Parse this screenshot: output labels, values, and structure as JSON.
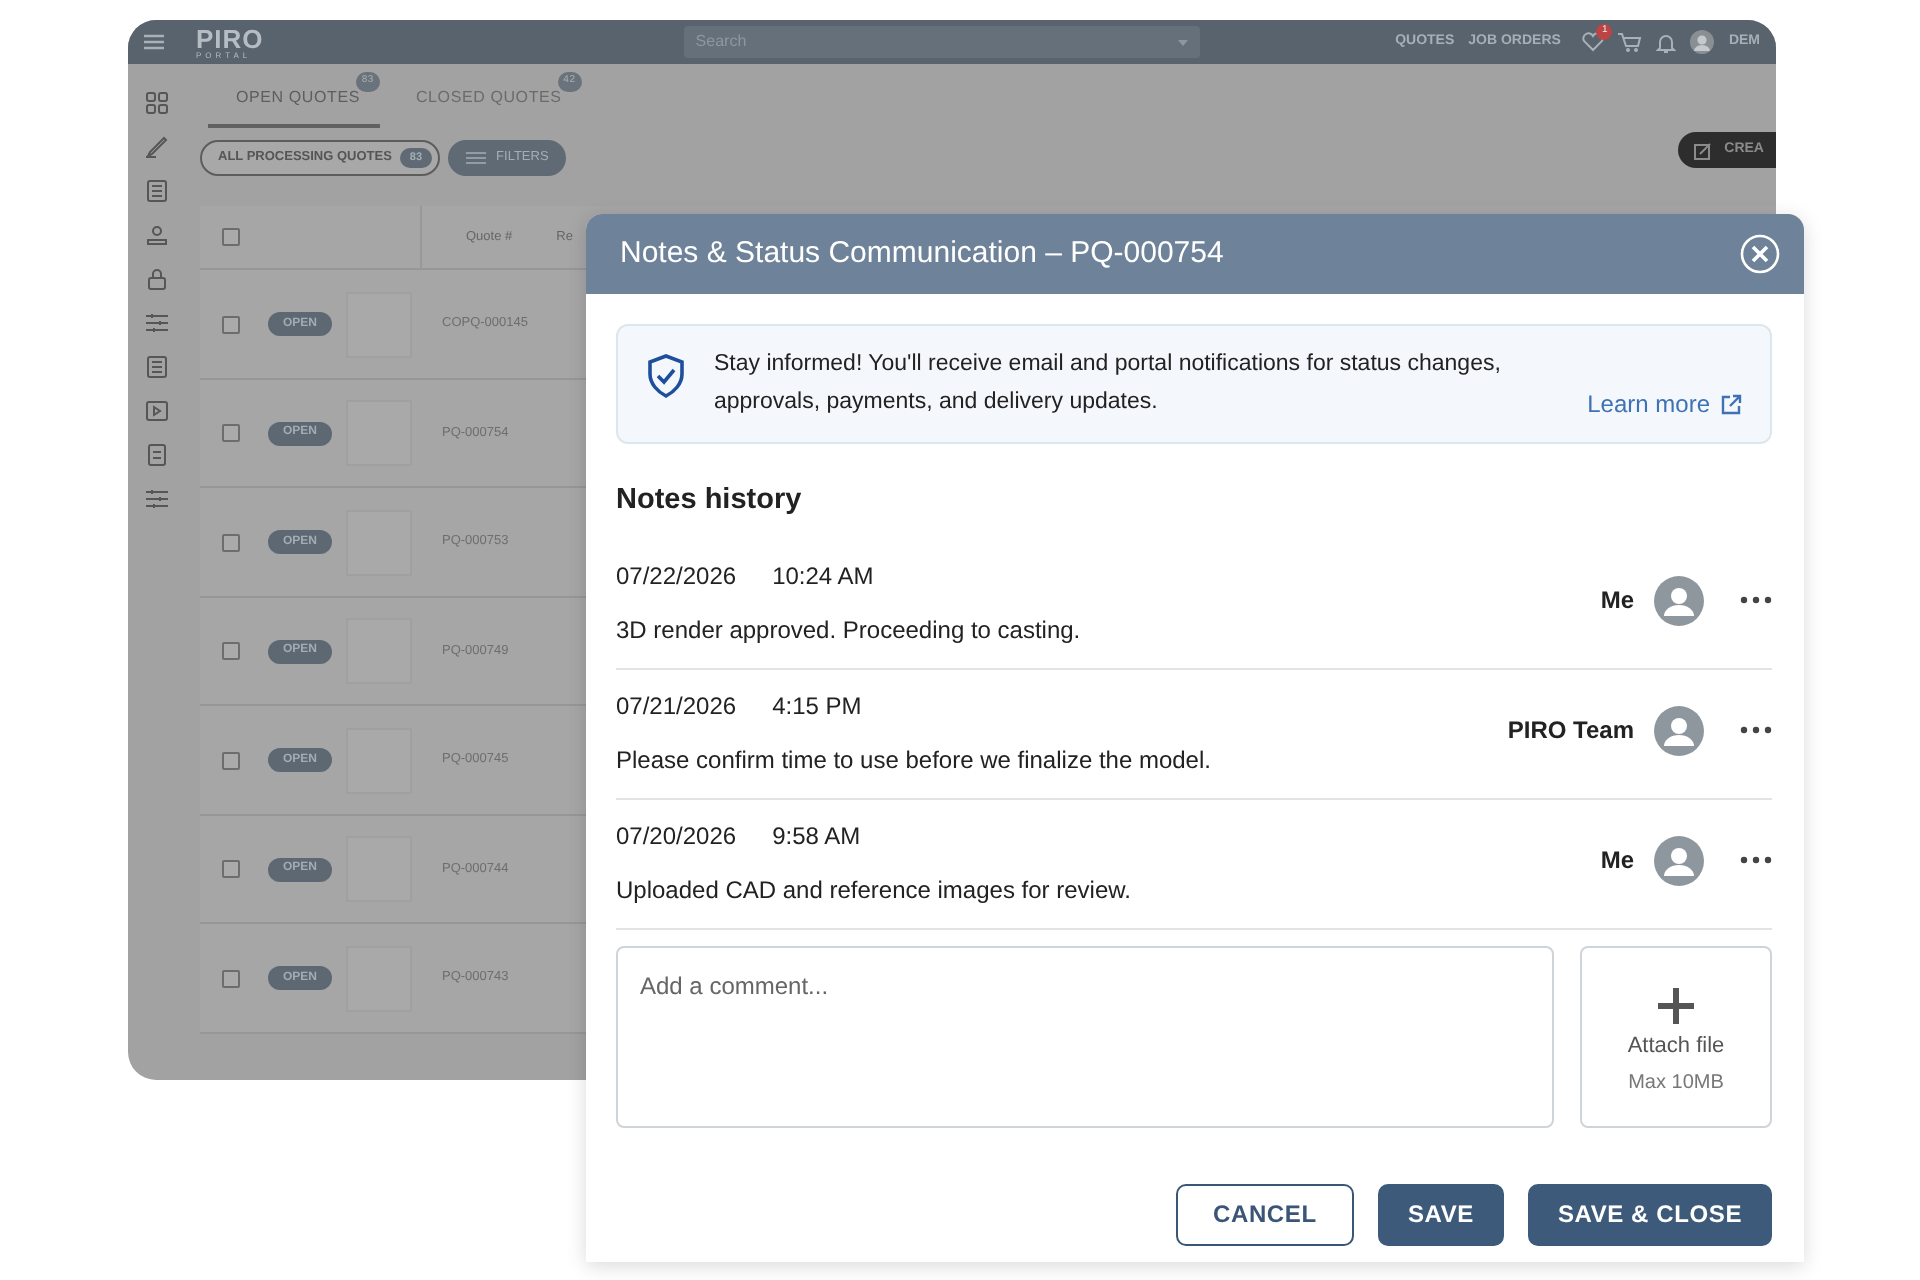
{
  "app": {
    "header": {
      "logo": "PIRO",
      "logo_sub": "PORTAL",
      "search": {
        "placeholder": "Search"
      },
      "nav_links": [
        "QUOTES",
        "JOB ORDERS"
      ],
      "wishlist_badge": "1",
      "user": "DEM"
    },
    "tabs": [
      {
        "label": "OPEN QUOTES",
        "count": "83",
        "selected": true
      },
      {
        "label": "CLOSED QUOTES",
        "count": "42",
        "selected": false
      }
    ],
    "filter_chip": {
      "label": "ALL PROCESSING QUOTES",
      "count": "83"
    },
    "filters_button": "FILTERS",
    "create_button": "CREA",
    "table": {
      "columns": [
        "Quote #",
        "Re"
      ],
      "all_checked": false,
      "rows": [
        {
          "status": "OPEN",
          "quote": "COPQ-000145",
          "checked": false
        },
        {
          "status": "OPEN",
          "quote": "PQ-000754",
          "checked": false
        },
        {
          "status": "OPEN",
          "quote": "PQ-000753",
          "checked": false
        },
        {
          "status": "OPEN",
          "quote": "PQ-000749",
          "checked": false
        },
        {
          "status": "OPEN",
          "quote": "PQ-000745",
          "checked": false
        },
        {
          "status": "OPEN",
          "quote": "PQ-000744",
          "checked": false
        },
        {
          "status": "OPEN",
          "quote": "PQ-000743",
          "checked": false
        }
      ]
    }
  },
  "modal": {
    "title": "Notes & Status Communication – PQ-000754",
    "info": {
      "text": "Stay informed! You'll receive email and portal notifications for status changes, approvals, payments, and delivery updates.",
      "link": "Learn more"
    },
    "history_title": "Notes history",
    "notes": [
      {
        "date": "07/22/2026",
        "time": "10:24 AM",
        "text": "3D render approved. Proceeding to casting.",
        "author": "Me"
      },
      {
        "date": "07/21/2026",
        "time": "4:15 PM",
        "text": "Please confirm time to use before we finalize the model.",
        "author": "PIRO Team"
      },
      {
        "date": "07/20/2026",
        "time": "9:58 AM",
        "text": "Uploaded CAD and reference images for review.",
        "author": "Me"
      }
    ],
    "comment": {
      "placeholder": "Add a comment..."
    },
    "attach": {
      "label": "Attach file",
      "hint": "Max 10MB"
    },
    "buttons": [
      {
        "label": "CANCEL",
        "kind": "outline"
      },
      {
        "label": "SAVE",
        "kind": "primary"
      },
      {
        "label": "SAVE & CLOSE",
        "kind": "primary"
      }
    ]
  }
}
